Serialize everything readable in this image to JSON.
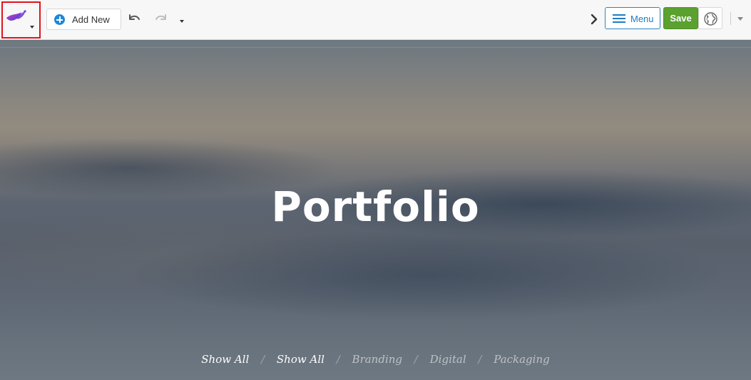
{
  "toolbar": {
    "logo_icon": "logo-bird-icon",
    "add_new_label": "Add New",
    "menu_label": "Menu",
    "save_label": "Save"
  },
  "hero": {
    "title": "Portfolio",
    "filters": [
      {
        "label": "Show All",
        "active": true
      },
      {
        "label": "Show All",
        "active": true
      },
      {
        "label": "Branding",
        "active": false
      },
      {
        "label": "Digital",
        "active": false
      },
      {
        "label": "Packaging",
        "active": false
      }
    ],
    "separator": "/"
  },
  "colors": {
    "accent_blue": "#1e7dc2",
    "save_green": "#5aa12f",
    "highlight_red": "#e0141e"
  }
}
